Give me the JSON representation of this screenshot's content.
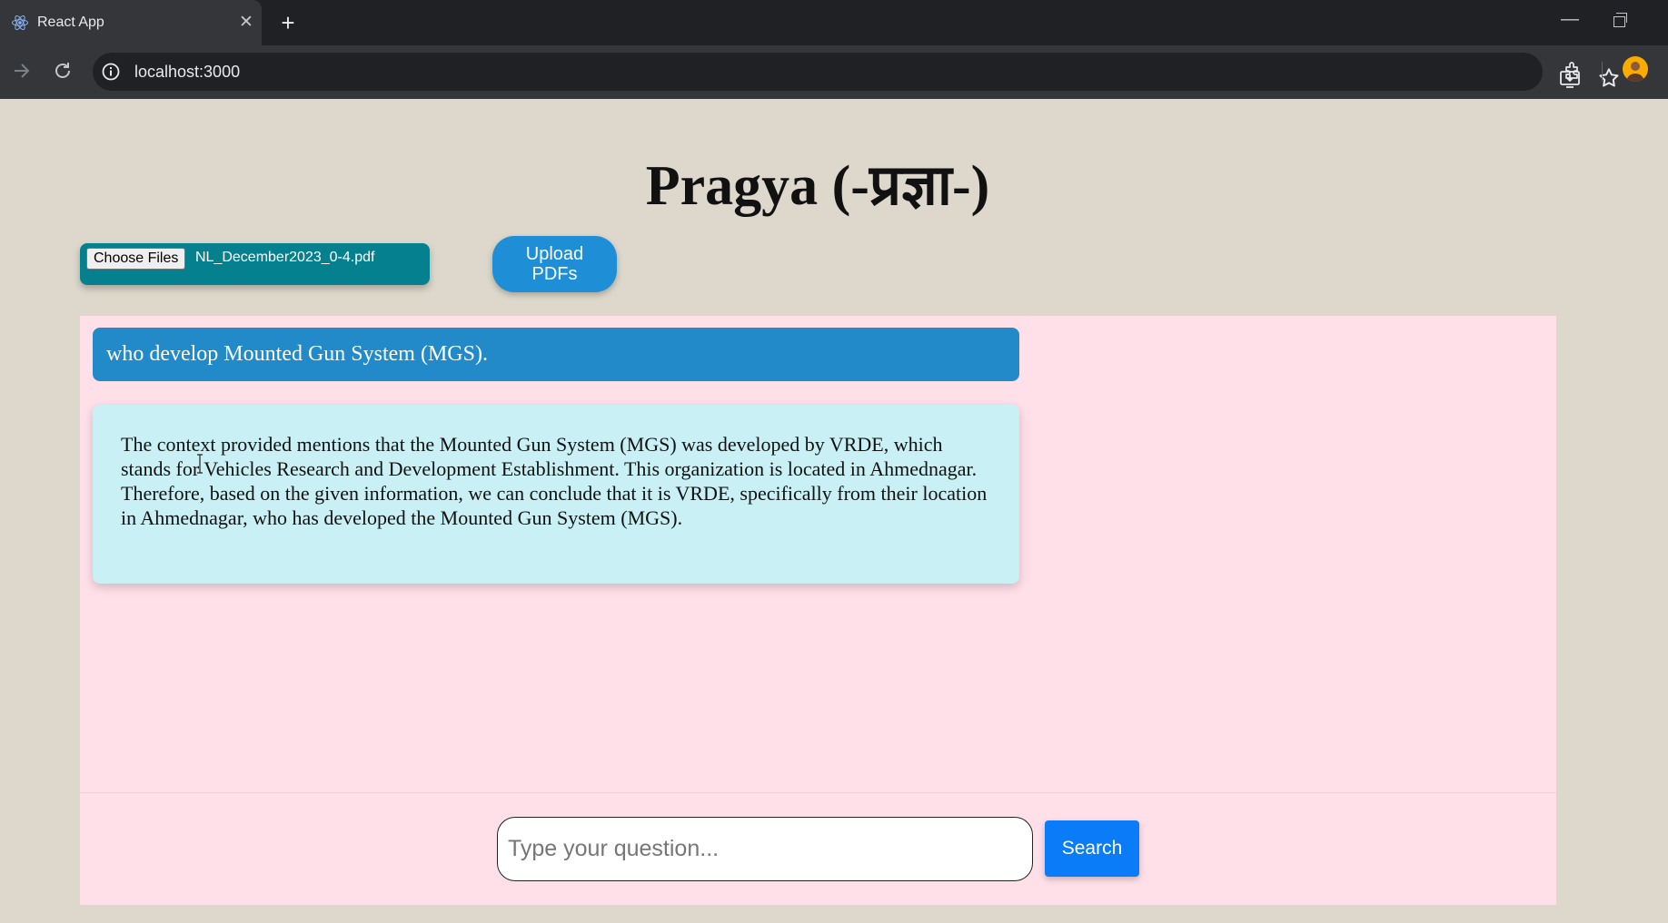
{
  "browser": {
    "tab_title": "React App",
    "url": "localhost:3000",
    "close_glyph": "✕",
    "new_tab_glyph": "+",
    "minimize_glyph": "—"
  },
  "page": {
    "title": "Pragya (-प्रज्ञा-)"
  },
  "upload": {
    "choose_files_label": "Choose Files",
    "selected_file": "NL_December2023_0-4.pdf",
    "upload_button_line1": "Upload",
    "upload_button_line2": "PDFs"
  },
  "chat": {
    "question": "who develop Mounted Gun System (MGS).",
    "answer": "The context provided mentions that the Mounted Gun System (MGS) was developed by VRDE, which stands for Vehicles Research and Development Establishment. This organization is located in Ahmednagar. Therefore, based on the given information, we can conclude that it is VRDE, specifically from their location in Ahmednagar, who has developed the Mounted Gun System (MGS)."
  },
  "input": {
    "placeholder": "Type your question...",
    "value": "",
    "search_label": "Search"
  },
  "icons": {
    "tab_favicon": "react-logo-icon",
    "forward": "arrow-forward-icon",
    "reload": "reload-icon",
    "site_info": "info-icon",
    "install": "install-app-icon",
    "bookmark": "star-icon",
    "extensions": "puzzle-icon",
    "profile": "avatar"
  },
  "colors": {
    "page_bg": "#ddd8cb",
    "chat_bg": "#ffdfe8",
    "user_bubble": "#228ac8",
    "answer_bubble": "#c8f0f5",
    "file_picker": "#04808f",
    "upload_button": "#1e8fd6",
    "search_button": "#0a7cf8"
  }
}
